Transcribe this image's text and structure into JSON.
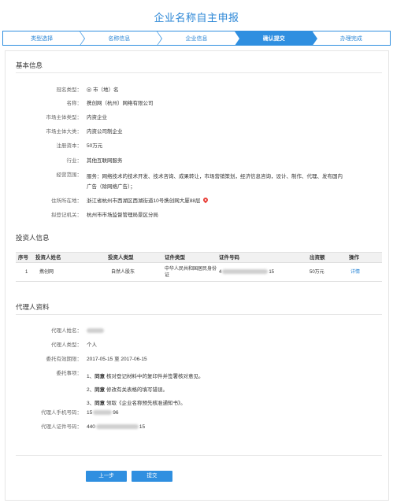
{
  "page": {
    "title": "企业名称自主申报"
  },
  "steps": [
    {
      "label": "类型选择",
      "active": false
    },
    {
      "label": "名称信息",
      "active": false
    },
    {
      "label": "企业信息",
      "active": false
    },
    {
      "label": "确认提交",
      "active": true
    },
    {
      "label": "办理完成",
      "active": false
    }
  ],
  "basic": {
    "section_title": "基本信息",
    "rows": [
      {
        "label": "冠名类型：",
        "value": "市（地）名"
      },
      {
        "label": "名称：",
        "value": "携创网（杭州）网络有限公司"
      },
      {
        "label": "市场主体类型：",
        "value": "内资企业"
      },
      {
        "label": "市场主体大类：",
        "value": "内资公司制企业"
      },
      {
        "label": "注册资本：",
        "value": "50万元"
      },
      {
        "label": "行业：",
        "value": "其他互联网服务"
      },
      {
        "label": "经营范围：",
        "value": "服务：网络技术的技术开发、技术咨询、成果转让，市场营销策划，经济信息咨询，设计、制作、代理、发布国内广告（除网络广告）；"
      },
      {
        "label": "住所所在地：",
        "value": "浙江省杭州市西湖区西湖街道10号携创网大厦88层"
      },
      {
        "label": "拟登记机关：",
        "value": "杭州市市场监督管理局景区分局"
      }
    ]
  },
  "investors": {
    "section_title": "投资人信息",
    "columns": [
      "序号",
      "投资人姓名",
      "投资人类型",
      "证件类型",
      "证件号码",
      "出资额",
      "操作"
    ],
    "rows": [
      {
        "index": "1",
        "name": "携创网",
        "type": "自然人股东",
        "id_type": "中华人民共和国居民身份证",
        "id_prefix": "4",
        "id_suffix": "15",
        "amount": "50万元",
        "action": "详情"
      }
    ]
  },
  "agent": {
    "section_title": "代理人资料",
    "name_label": "代理人姓名：",
    "type_label": "代理人类型：",
    "type_value": "个人",
    "period_label": "委托有效期限：",
    "period_start": "2017-05-15",
    "period_sep": "至",
    "period_end": "2017-06-15",
    "matters_label": "委托事项：",
    "matters": [
      {
        "prefix": "1、",
        "tag": "同意",
        "text": "核对登记材料中的复印件并签署核对意见。"
      },
      {
        "prefix": "2、",
        "tag": "同意",
        "text": "修改有关表格的填写错误。"
      },
      {
        "prefix": "3、",
        "tag": "同意",
        "text": "领取《企业名称预先核准通知书》。"
      }
    ],
    "phone_label": "代理人手机号码：",
    "phone_prefix": "15",
    "phone_suffix": "96",
    "cert_label": "代理人证件号码：",
    "cert_prefix": "440",
    "cert_suffix": "15"
  },
  "actions": {
    "prev_label": "上一步",
    "submit_label": "提交"
  }
}
